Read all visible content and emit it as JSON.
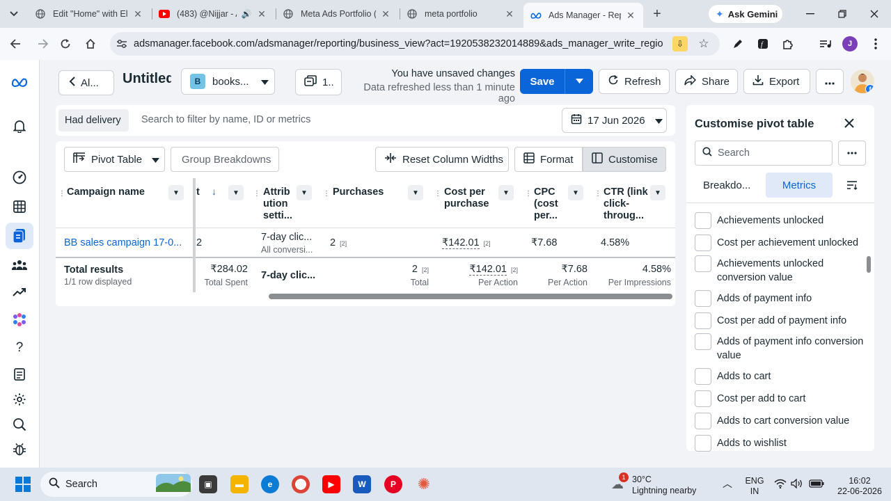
{
  "browser": {
    "tabs": [
      {
        "title": "Edit \"Home\" with Ele",
        "favicon": "globe-icon"
      },
      {
        "title": "(483) @Nijjar - A",
        "favicon": "youtube-icon"
      },
      {
        "title": "Meta Ads Portfolio (",
        "favicon": "globe-icon"
      },
      {
        "title": "meta portfolio",
        "favicon": "globe-icon"
      },
      {
        "title": "Ads Manager - Repo",
        "favicon": "meta-icon"
      }
    ],
    "ask_gemini": "Ask Gemini",
    "url": "adsmanager.facebook.com/adsmanager/reporting/business_view?act=1920538232014889&ads_manager_write_regions=...",
    "profile_initial": "J"
  },
  "header": {
    "back_label": "Al...",
    "title": "Untitled",
    "account_letter": "B",
    "account_label": "books...",
    "version_label": "1..",
    "unsaved_text": "You have unsaved changes",
    "refreshed_text": "Data refreshed less than 1 minute ago",
    "save_label": "Save",
    "refresh_label": "Refresh",
    "share_label": "Share",
    "export_label": "Export"
  },
  "filter": {
    "chip": "Had delivery",
    "placeholder": "Search to filter by name, ID or metrics",
    "date": "17 Jun 2026"
  },
  "toolbar": {
    "pivot": "Pivot Table",
    "group": "Group Breakdowns",
    "reset": "Reset Column Widths",
    "format": "Format",
    "customise": "Customise"
  },
  "table": {
    "columns": {
      "campaign": "Campaign name",
      "spent": "t",
      "attribution": [
        "Attrib",
        "ution",
        "setti..."
      ],
      "purchases": "Purchases",
      "cpp": [
        "Cost per",
        "purchase"
      ],
      "cpc": [
        "CPC",
        "(cost",
        "per..."
      ],
      "ctr": [
        "CTR (link",
        "click-",
        "throug..."
      ]
    },
    "row": {
      "campaign": "BB sales campaign 17-0...",
      "spent": "2",
      "attribution": "7-day clic...",
      "attribution_sub": "All conversi...",
      "purchases": "2",
      "purchases_ref": "[2]",
      "cpp": "₹142.01",
      "cpp_ref": "[2]",
      "cpc": "₹7.68",
      "ctr": "4.58%"
    },
    "total": {
      "label": "Total results",
      "sub": "1/1 row displayed",
      "spent": "₹284.02",
      "spent_sub": "Total Spent",
      "attribution": "7-day clic...",
      "purchases": "2",
      "purchases_ref": "[2]",
      "purchases_sub": "Total",
      "cpp": "₹142.01",
      "cpp_ref": "[2]",
      "cpp_sub": "Per Action",
      "cpc": "₹7.68",
      "cpc_sub": "Per Action",
      "ctr": "4.58%",
      "ctr_sub": "Per Impressions"
    }
  },
  "panel": {
    "title": "Customise pivot table",
    "search_placeholder": "Search",
    "tab_breakdowns": "Breakdo...",
    "tab_metrics": "Metrics",
    "metrics": [
      "Achievements unlocked",
      "Cost per achievement unlocked",
      "Achievements unlocked conversion value",
      "Adds of payment info",
      "Cost per add of payment info",
      "Adds of payment info conversion value",
      "Adds to cart",
      "Cost per add to cart",
      "Adds to cart conversion value",
      "Adds to wishlist"
    ]
  },
  "taskbar": {
    "search": "Search",
    "weather_badge": "1",
    "weather_temp": "30°C",
    "weather_desc": "Lightning nearby",
    "lang_1": "ENG",
    "lang_2": "IN",
    "time": "16:02",
    "date": "22-06-2026"
  },
  "colors": {
    "accent": "#0a66d8",
    "meta_blue": "#0668e1",
    "active_tab_bg": "#dfe9f7"
  }
}
